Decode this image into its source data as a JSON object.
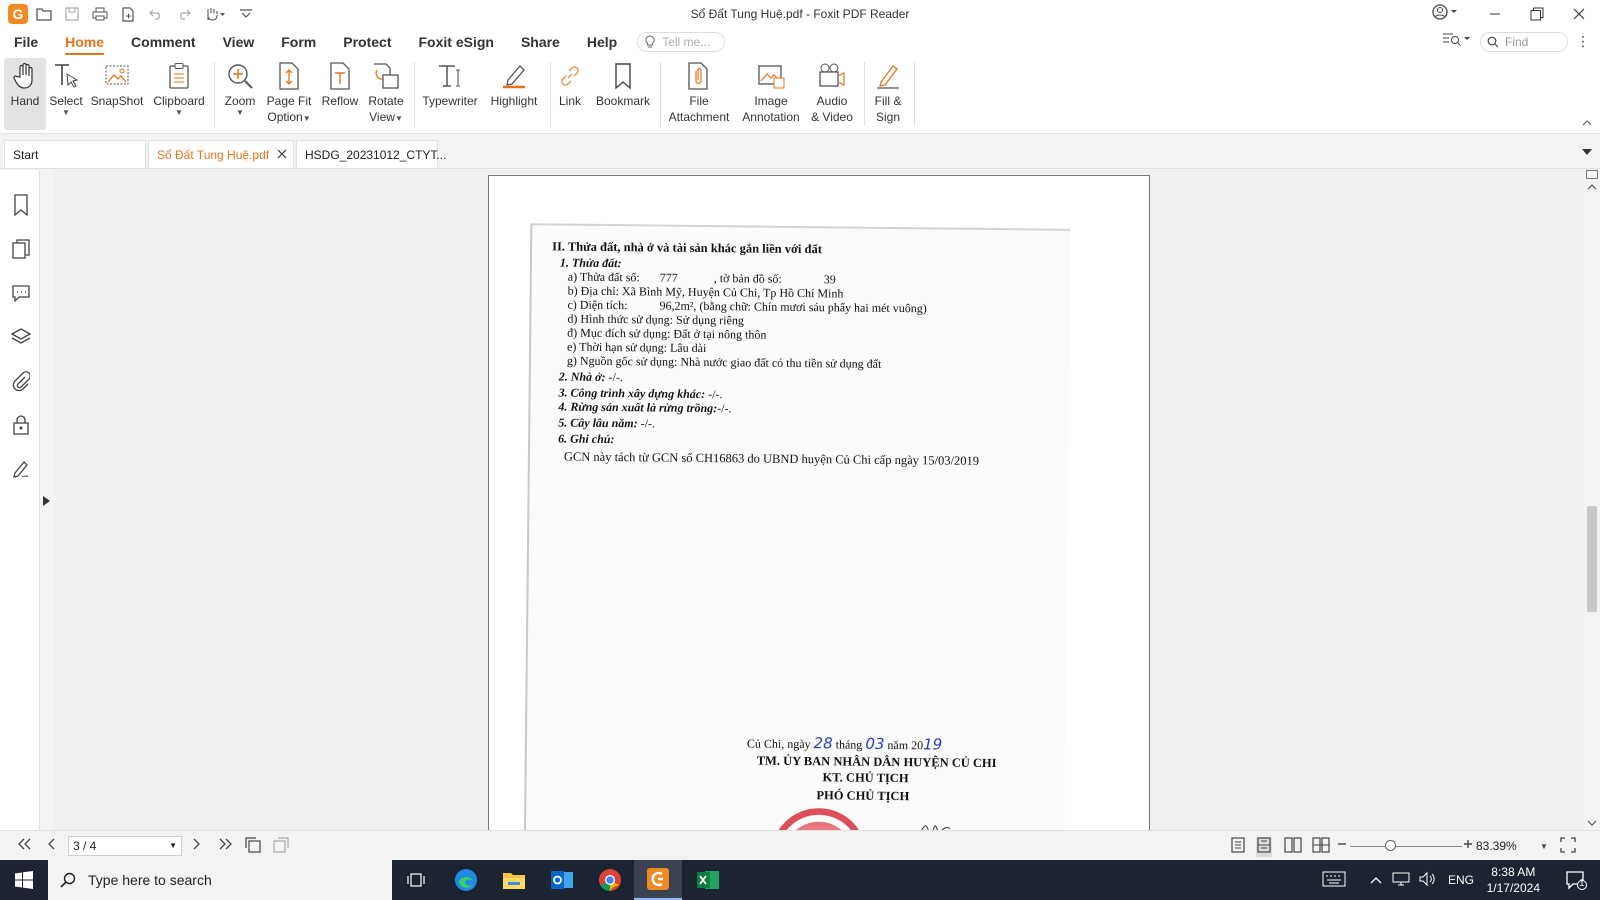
{
  "window": {
    "title": "Sổ Đất Tung Huệ.pdf - Foxit PDF Reader",
    "logo_letter": "G"
  },
  "menu": {
    "tabs": [
      {
        "label": "File"
      },
      {
        "label": "Home"
      },
      {
        "label": "Comment"
      },
      {
        "label": "View"
      },
      {
        "label": "Form"
      },
      {
        "label": "Protect"
      },
      {
        "label": "Foxit eSign"
      },
      {
        "label": "Share"
      },
      {
        "label": "Help"
      }
    ],
    "active_tab": "Home",
    "tell_me_placeholder": "Tell me...",
    "find_placeholder": "Find"
  },
  "ribbon": {
    "hand": {
      "line1": "Hand",
      "line2": ""
    },
    "select": {
      "line1": "Select",
      "line2": ""
    },
    "snapshot": {
      "line1": "SnapShot",
      "line2": ""
    },
    "clipboard": {
      "line1": "Clipboard",
      "line2": ""
    },
    "zoom": {
      "line1": "Zoom",
      "line2": ""
    },
    "pagefit": {
      "line1": "Page Fit",
      "line2": "Option"
    },
    "reflow": {
      "line1": "Reflow",
      "line2": ""
    },
    "rotate": {
      "line1": "Rotate",
      "line2": "View"
    },
    "typewriter": {
      "line1": "Typewriter",
      "line2": ""
    },
    "highlight": {
      "line1": "Highlight",
      "line2": ""
    },
    "link": {
      "line1": "Link",
      "line2": ""
    },
    "bookmark": {
      "line1": "Bookmark",
      "line2": ""
    },
    "fileattach": {
      "line1": "File",
      "line2": "Attachment"
    },
    "imageannot": {
      "line1": "Image",
      "line2": "Annotation"
    },
    "audiovideo": {
      "line1": "Audio",
      "line2": "& Video"
    },
    "fillsign": {
      "line1": "Fill &",
      "line2": "Sign"
    }
  },
  "doc_tabs": {
    "start": "Start",
    "active": "Sổ Đất Tung Huệ.pdf",
    "other": "HSDG_20231012_CTYT..."
  },
  "document": {
    "section_title": "II. Thửa đất, nhà ở và tài sản khác gắn liền với đất",
    "h1": "1. Thửa đất:",
    "a_label": "a) Thửa đất số:",
    "a_value": "777",
    "a_map_label": ", tờ bản đồ số:",
    "a_map_value": "39",
    "b": "b) Địa chỉ:  Xã Bình Mỹ, Huyện Củ Chi, Tp Hồ Chí Minh",
    "c_label": "c) Diện tích:",
    "c_value": "96,2m², (bằng chữ: Chín mươi sáu phẩy hai mét vuông)",
    "d": "d) Hình thức sử dụng:   Sử dụng riêng",
    "dd": "đ) Mục đích sử dụng:   Đất ở tại nông thôn",
    "e": "e) Thời hạn sử dụng:   Lâu dài",
    "g": "g) Nguồn gốc sử dụng:  Nhà nước giao đất có thu tiền sử dụng đất",
    "h2": "2. Nhà ở:",
    "h2_value": "-/-.",
    "h3": "3. Công trình xây dựng khác:",
    "h3_value": "-/-.",
    "h4": "4. Rừng sản xuất là rừng trồng:",
    "h4_value": "-/-.",
    "h5": "5. Cây lâu năm:",
    "h5_value": "-/-.",
    "h6": "6. Ghi chú:",
    "note": "GCN này tách từ GCN số CH16863 do UBND huyện Củ Chi cấp ngày 15/03/2019",
    "date_place": "Củ Chi, ngày",
    "date_day": "28",
    "date_month_label": "tháng",
    "date_month": "03",
    "date_year_label": "năm 20",
    "date_year": "19",
    "org": "TM. ỦY BAN NHÂN DÂN HUYỆN CỦ CHI",
    "kt": "KT. CHỦ TỊCH",
    "vice": "PHÓ CHỦ TỊCH"
  },
  "statusbar": {
    "page_indicator": "3 / 4",
    "zoom": "83.39%",
    "zoom_fraction": 0.36
  },
  "taskbar": {
    "search_placeholder": "Type here to search",
    "lang": "ENG",
    "time": "8:38 AM",
    "date": "1/17/2024",
    "notif_count": "1"
  },
  "colors": {
    "accent": "#e8731a",
    "taskbar": "#1c2331"
  }
}
